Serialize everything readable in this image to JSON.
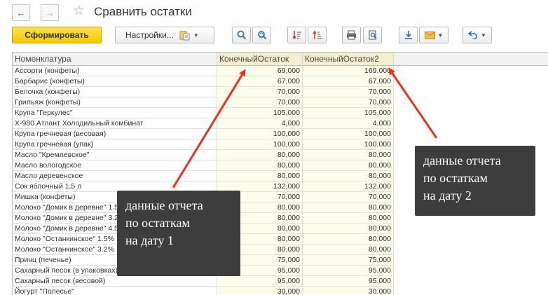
{
  "window": {
    "title": "Сравнить остатки"
  },
  "toolbar": {
    "generate_label": "Сформировать",
    "settings_label": "Настройки..."
  },
  "table": {
    "columns": [
      "Номенклатура",
      "КонечныйОстаток",
      "КонечныйОстаток2"
    ],
    "rows": [
      {
        "name": "Ассорти (конфеты)",
        "end1": "69,000",
        "end2": "169,000"
      },
      {
        "name": "Барбарис (конфеты)",
        "end1": "67,000",
        "end2": "67,000"
      },
      {
        "name": "Белочка (конфеты)",
        "end1": "70,000",
        "end2": "70,000"
      },
      {
        "name": "Грильяж (конфеты)",
        "end1": "70,000",
        "end2": "70,000"
      },
      {
        "name": "Крупа \"Геркулес\"",
        "end1": "105,000",
        "end2": "105,000"
      },
      {
        "name": "X-980 Атлант Холодильный комбинат",
        "end1": "4,000",
        "end2": "4,000"
      },
      {
        "name": "Крупа гречневая (весовая)",
        "end1": "100,000",
        "end2": "100,000"
      },
      {
        "name": "Крупа гречневая (упак)",
        "end1": "100,000",
        "end2": "100,000"
      },
      {
        "name": "Масло \"Кремлевское\"",
        "end1": "80,000",
        "end2": "80,000"
      },
      {
        "name": "Масло вологодское",
        "end1": "80,000",
        "end2": "80,000"
      },
      {
        "name": "Масло деревенское",
        "end1": "80,000",
        "end2": "80,000"
      },
      {
        "name": "Сок яблочный 1,5 л",
        "end1": "132,000",
        "end2": "132,000"
      },
      {
        "name": "Мишка (конфеты)",
        "end1": "70,000",
        "end2": "70,000"
      },
      {
        "name": "Молоко \"Домик в деревне\" 1.5%",
        "end1": "80,000",
        "end2": "80,000"
      },
      {
        "name": "Молоко \"Домик в деревне\" 3.2%",
        "end1": "80,000",
        "end2": "80,000"
      },
      {
        "name": "Молоко \"Домик в деревне\" 4.5%",
        "end1": "80,000",
        "end2": "80,000"
      },
      {
        "name": "Молоко \"Останкинское\" 1.5%",
        "end1": "80,000",
        "end2": "80,000"
      },
      {
        "name": "Молоко \"Останкинское\" 3.2%",
        "end1": "80,000",
        "end2": "80,000"
      },
      {
        "name": "Принц (печенье)",
        "end1": "75,000",
        "end2": "75,000"
      },
      {
        "name": "Сахарный песок (в упаковках)",
        "end1": "95,000",
        "end2": "95,000"
      },
      {
        "name": "Сахарный песок (весовой)",
        "end1": "95,000",
        "end2": "95,000"
      },
      {
        "name": "Йогурт \"Полесье\"",
        "end1": "30,000",
        "end2": "30,000"
      }
    ]
  },
  "annotations": {
    "left": [
      "данные отчета",
      "по остаткам",
      "на дату 1"
    ],
    "right": [
      "данные отчета",
      "по остаткам",
      "на дату 2"
    ]
  },
  "colors": {
    "accent_yellow": "#f5c700",
    "arrow_red": "#e53323",
    "callout_bg": "#3d3d3d"
  },
  "icons": [
    "back-arrow-icon",
    "forward-arrow-icon",
    "star-icon",
    "variant-icon",
    "search-icon",
    "search-refresh-icon",
    "sort-descending-icon",
    "sort-ascending-icon",
    "print-icon",
    "print-preview-icon",
    "download-icon",
    "envelope-icon",
    "undo-icon"
  ]
}
